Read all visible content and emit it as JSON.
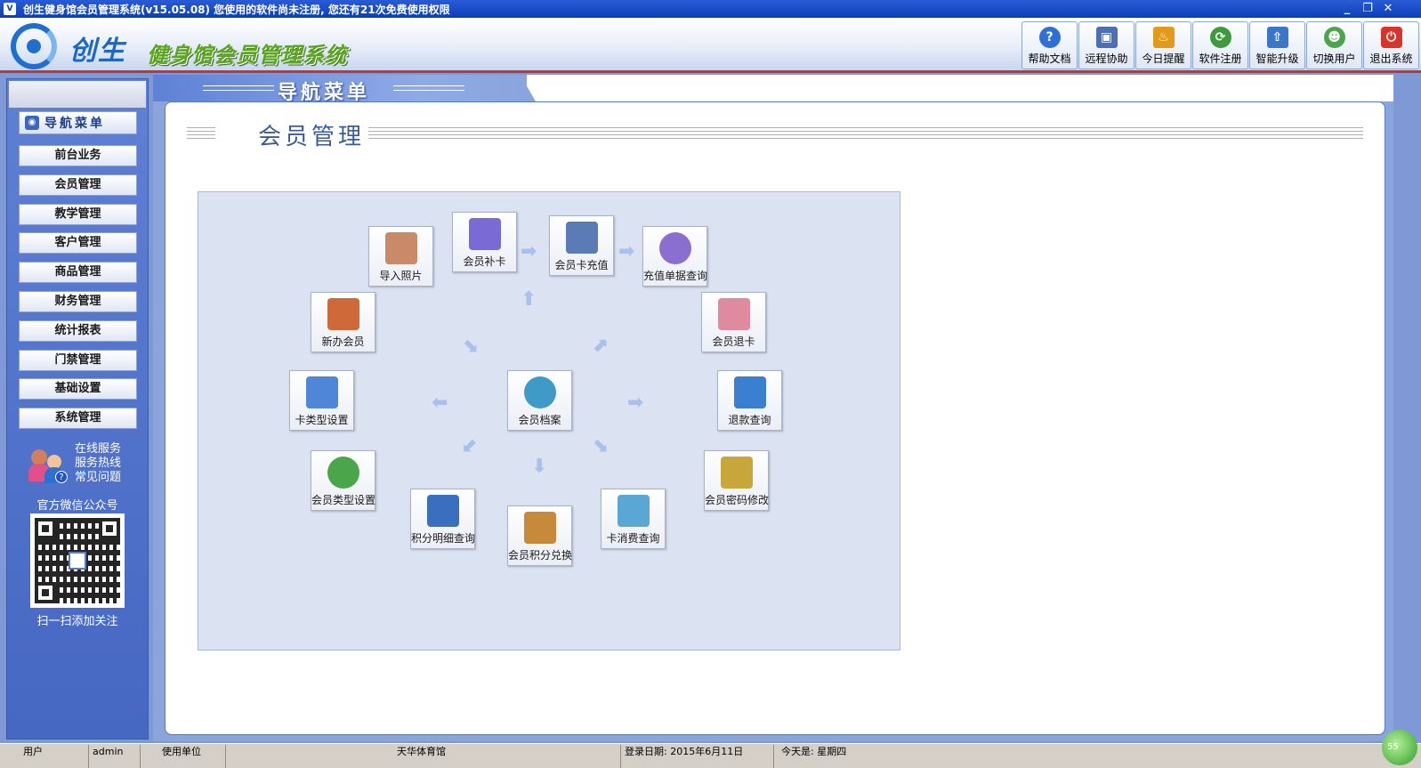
{
  "window": {
    "title": "创生健身馆会员管理系统(v15.05.08)  您使用的软件尚未注册, 您还有21次免费使用权限",
    "controls": [
      "_",
      "❐",
      "✕"
    ]
  },
  "header": {
    "brand": "创生",
    "system_name": "健身馆会员管理系统"
  },
  "toolbar": [
    {
      "label": "帮助文档",
      "icon": "help-icon",
      "color": "#2f6fd6",
      "glyph": "?"
    },
    {
      "label": "远程协助",
      "icon": "remote-icon",
      "color": "#4a6fb3",
      "glyph": "▣"
    },
    {
      "label": "今日提醒",
      "icon": "cake-icon",
      "color": "#e39a1b",
      "glyph": "♨"
    },
    {
      "label": "软件注册",
      "icon": "register-icon",
      "color": "#3c9b3c",
      "glyph": "⟳"
    },
    {
      "label": "智能升级",
      "icon": "upgrade-icon",
      "color": "#3a76c9",
      "glyph": "⇧"
    },
    {
      "label": "切换用户",
      "icon": "switch-user-icon",
      "color": "#4aa64a",
      "glyph": "☻"
    },
    {
      "label": "退出系统",
      "icon": "exit-icon",
      "color": "#d8352a",
      "glyph": "⏻"
    }
  ],
  "sidebar": {
    "header": "导航菜单",
    "items": [
      "前台业务",
      "会员管理",
      "教学管理",
      "客户管理",
      "商品管理",
      "财务管理",
      "统计报表",
      "门禁管理",
      "基础设置",
      "系统管理"
    ],
    "service_links": [
      "在线服务",
      "服务热线",
      "常见问题"
    ],
    "wechat_title": "官方微信公众号",
    "scan_text": "扫一扫添加关注"
  },
  "main": {
    "banner_title": "导航菜单",
    "section_title": "会员管理",
    "functions": [
      {
        "label": "导入照片",
        "icon": "camera-icon",
        "color": "#c98a6a"
      },
      {
        "label": "会员补卡",
        "icon": "notebook-icon",
        "color": "#7a6ad6"
      },
      {
        "label": "会员卡充值",
        "icon": "card-machine-icon",
        "color": "#5a7bb5"
      },
      {
        "label": "充值单据查询",
        "icon": "magnifier-icon",
        "color": "#8a6fd0"
      },
      {
        "label": "新办会员",
        "icon": "new-member-icon",
        "color": "#d0693a"
      },
      {
        "label": "会员退卡",
        "icon": "money-icon",
        "color": "#e08aa0"
      },
      {
        "label": "卡类型设置",
        "icon": "tools-icon",
        "color": "#4f86d6"
      },
      {
        "label": "会员档案",
        "icon": "member-file-icon",
        "color": "#3f9ac8"
      },
      {
        "label": "退款查询",
        "icon": "refund-icon",
        "color": "#3a7fd0"
      },
      {
        "label": "会员类型设置",
        "icon": "member-type-icon",
        "color": "#4aa64a"
      },
      {
        "label": "会员密码修改",
        "icon": "keys-icon",
        "color": "#c7a63a"
      },
      {
        "label": "积分明细查询",
        "icon": "book-icon",
        "color": "#3a6fc0"
      },
      {
        "label": "会员积分兑换",
        "icon": "gift-box-icon",
        "color": "#c78a3a"
      },
      {
        "label": "卡消费查询",
        "icon": "card-pen-icon",
        "color": "#5aa7d6"
      }
    ]
  },
  "statusbar": {
    "user_label": "用户",
    "user_value": "admin",
    "unit_label": "使用单位",
    "unit_value": "天华体育馆",
    "login_label": "登录日期: 2015年6月11日",
    "today_label": "今天是: 星期四"
  }
}
